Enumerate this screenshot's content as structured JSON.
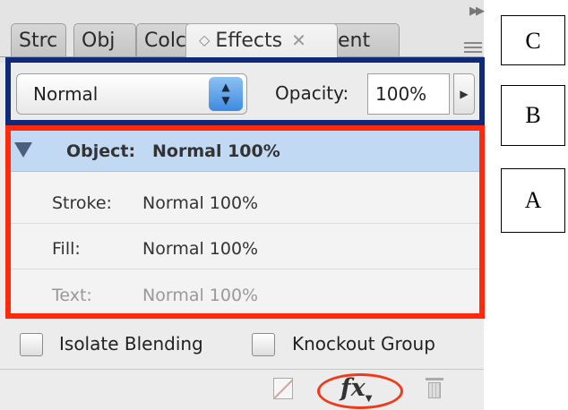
{
  "tabs": {
    "stroke": "Strc",
    "object_styles": "Obj",
    "color": "Colc",
    "effects": "Effects",
    "gradient": "ent"
  },
  "blend_mode": {
    "selected": "Normal"
  },
  "opacity": {
    "label": "Opacity:",
    "value": "100%"
  },
  "targets": [
    {
      "label": "Object:",
      "value": "Normal 100%"
    },
    {
      "label": "Stroke:",
      "value": "Normal 100%"
    },
    {
      "label": "Fill:",
      "value": "Normal 100%"
    },
    {
      "label": "Text:",
      "value": "Normal 100%"
    }
  ],
  "options": {
    "isolate_blending": "Isolate Blending",
    "knockout_group": "Knockout Group"
  },
  "bottom_bar": {
    "fx_label": "fx"
  },
  "icons": {
    "panel_menu": "panel-menu-icon",
    "collapse": "collapse-arrows-icon",
    "clear_effects": "clear-effects-icon",
    "add_effect": "fx-icon",
    "delete": "trash-icon"
  },
  "callouts": {
    "c": "C",
    "b": "B",
    "a": "A"
  },
  "colors": {
    "callout_a_border": "#ff2a0c",
    "callout_b_border": "#102a7a",
    "fx_highlight": "#ee3b1b",
    "selected_row": "#c2d9f4",
    "stepper_blue": "#3d8ae0"
  }
}
